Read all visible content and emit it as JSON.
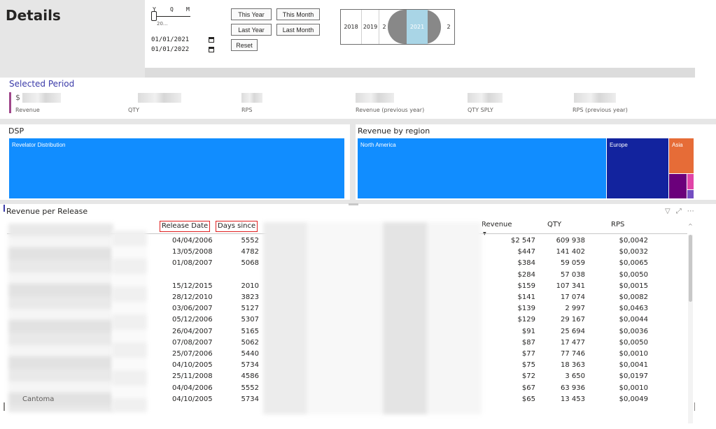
{
  "header": {
    "title": "Details",
    "ymd": {
      "y": "Y",
      "q": "Q",
      "m": "M",
      "sub": "20..."
    },
    "date_from": "01/01/2021",
    "date_to": "01/01/2022",
    "buttons": {
      "this_year": "This Year",
      "this_month": "This Month",
      "last_year": "Last Year",
      "last_month": "Last Month",
      "reset": "Reset"
    },
    "year_slicer": {
      "years": [
        "2018",
        "2019",
        "2"
      ],
      "selected": "2021",
      "after": "2"
    }
  },
  "selected_period": {
    "title": "Selected Period",
    "mark": "$",
    "kpis": [
      {
        "label": "Revenue"
      },
      {
        "label": "QTY"
      },
      {
        "label": "RPS"
      },
      {
        "label": "Revenue (previous year)"
      },
      {
        "label": "QTY SPLY"
      },
      {
        "label": "RPS (previous year)"
      }
    ]
  },
  "dsp": {
    "title": "DSP",
    "tiles": [
      {
        "label": "Revelator Distribution",
        "color": "#118dff"
      }
    ]
  },
  "region": {
    "title": "Revenue by region",
    "tiles": [
      {
        "label": "North America",
        "color": "#118dff"
      },
      {
        "label": "Europe",
        "color": "#12239e"
      },
      {
        "label": "Asia",
        "color": "#e66c37"
      },
      {
        "label": "",
        "color": "#6b007b"
      },
      {
        "label": "",
        "color": "#e044a7"
      },
      {
        "label": "",
        "color": "#744ec2"
      }
    ]
  },
  "table": {
    "title": "Revenue per Release",
    "columns": {
      "release_date": "Release Date",
      "days_since": "Days since",
      "revenue": "Revenue",
      "qty": "QTY",
      "rps": "RPS"
    },
    "rows": [
      {
        "date": "04/04/2006",
        "days": "5552",
        "revenue": "$2 547",
        "qty": "609 938",
        "rps": "$0,0042"
      },
      {
        "date": "13/05/2008",
        "days": "4782",
        "revenue": "$447",
        "qty": "141 402",
        "rps": "$0,0032"
      },
      {
        "date": "01/08/2007",
        "days": "5068",
        "revenue": "$384",
        "qty": "59 059",
        "rps": "$0,0065"
      },
      {
        "date": "",
        "days": "",
        "revenue": "$284",
        "qty": "57 038",
        "rps": "$0,0050"
      },
      {
        "date": "15/12/2015",
        "days": "2010",
        "revenue": "$159",
        "qty": "107 341",
        "rps": "$0,0015"
      },
      {
        "date": "28/12/2010",
        "days": "3823",
        "revenue": "$141",
        "qty": "17 074",
        "rps": "$0,0082"
      },
      {
        "date": "03/06/2007",
        "days": "5127",
        "revenue": "$139",
        "qty": "2 997",
        "rps": "$0,0463"
      },
      {
        "date": "05/12/2006",
        "days": "5307",
        "revenue": "$129",
        "qty": "29 167",
        "rps": "$0,0044"
      },
      {
        "date": "26/04/2007",
        "days": "5165",
        "revenue": "$91",
        "qty": "25 694",
        "rps": "$0,0036"
      },
      {
        "date": "07/08/2007",
        "days": "5062",
        "revenue": "$87",
        "qty": "17 477",
        "rps": "$0,0050"
      },
      {
        "date": "25/07/2006",
        "days": "5440",
        "revenue": "$77",
        "qty": "77 746",
        "rps": "$0,0010"
      },
      {
        "date": "04/10/2005",
        "days": "5734",
        "revenue": "$75",
        "qty": "18 363",
        "rps": "$0,0041"
      },
      {
        "date": "25/11/2008",
        "days": "4586",
        "revenue": "$72",
        "qty": "3 650",
        "rps": "$0,0197"
      },
      {
        "date": "04/04/2006",
        "days": "5552",
        "revenue": "$67",
        "qty": "63 936",
        "rps": "$0,0010"
      },
      {
        "date": "04/10/2005",
        "days": "5734",
        "revenue": "$65",
        "qty": "13 453",
        "rps": "$0,0049",
        "name": "Cantoma"
      }
    ]
  },
  "icons": [
    "filter-icon",
    "focus-mode-icon",
    "more-options-icon",
    "calendar-icon"
  ]
}
